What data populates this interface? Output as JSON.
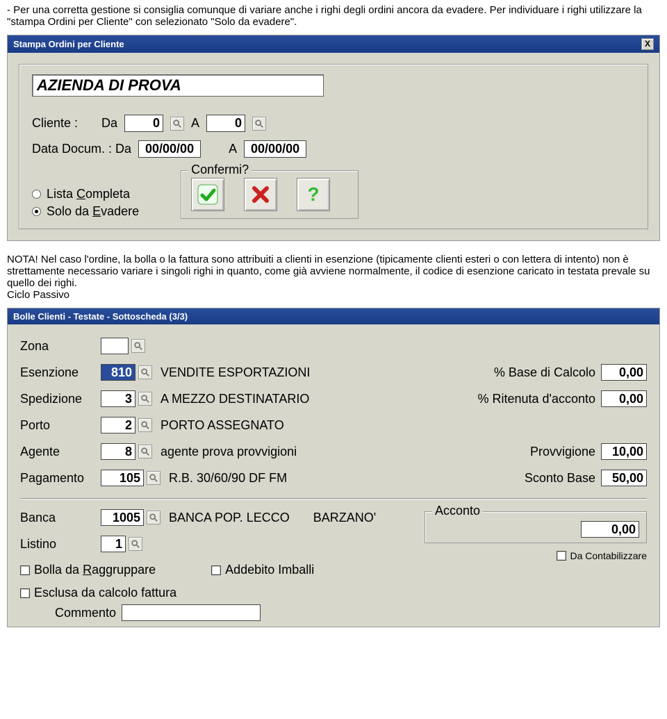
{
  "intro": {
    "line1": "- Per una corretta gestione si consiglia comunque di variare anche i righi degli ordini ancora da evadere. Per individuare i righi utilizzare la \"stampa Ordini per Cliente\" con selezionato \"Solo da evadere\"."
  },
  "win1": {
    "title": "Stampa Ordini per Cliente",
    "close": "X",
    "company": "AZIENDA DI PROVA",
    "cliente_label": "Cliente :",
    "da": "Da",
    "a": "A",
    "cliente_from": "0",
    "cliente_to": "0",
    "data_label": "Data Docum. : Da",
    "date_from": "00/00/00",
    "date_to": "00/00/00",
    "radio1a": "Lista ",
    "radio1b": "C",
    "radio1c": "ompleta",
    "radio2a": "Solo da ",
    "radio2b": "E",
    "radio2c": "vadere",
    "confirm": "Confermi?"
  },
  "note": {
    "text": "NOTA! Nel caso l'ordine, la bolla o la fattura sono attribuiti a clienti in esenzione (tipicamente clienti esteri o con lettera di intento) non è strettamente necessario variare i singoli righi in quanto, come già avviene normalmente, il codice di esenzione caricato in testata prevale su quello dei righi.",
    "ciclo": "Ciclo Passivo"
  },
  "win2": {
    "title": "Bolle Clienti - Testate - Sottoscheda (3/3)",
    "zona_lbl": "Zona",
    "esenzione_lbl": "Esenzione",
    "esenzione": "810",
    "esenzione_desc": "VENDITE ESPORTAZIONI",
    "spedizione_lbl": "Spedizione",
    "spedizione": "3",
    "spedizione_desc": "A MEZZO DESTINATARIO",
    "porto_lbl": "Porto",
    "porto": "2",
    "porto_desc": "PORTO ASSEGNATO",
    "agente_lbl": "Agente",
    "agente": "8",
    "agente_desc": "agente prova provvigioni",
    "pagamento_lbl": "Pagamento",
    "pagamento": "105",
    "pagamento_desc": "R.B. 30/60/90 DF FM",
    "base_lbl": "% Base di Calcolo",
    "base": "0,00",
    "ritenuta_lbl": "% Ritenuta d'acconto",
    "ritenuta": "0,00",
    "provvigione_lbl": "Provvigione",
    "provvigione": "10,00",
    "sconto_lbl": "Sconto Base",
    "sconto": "50,00",
    "banca_lbl": "Banca",
    "banca": "1005",
    "banca_desc1": "BANCA POP. LECCO",
    "banca_desc2": "BARZANO'",
    "listino_lbl": "Listino",
    "listino": "1",
    "acconto_lbl": "Acconto",
    "acconto": "0,00",
    "chk1a": "Bolla da ",
    "chk1b": "R",
    "chk1c": "aggruppare",
    "chk2": "Addebito Imballi",
    "chk3": "Da Contabilizzare",
    "chk4": "Esclusa da calcolo fattura",
    "commento": "Commento"
  }
}
